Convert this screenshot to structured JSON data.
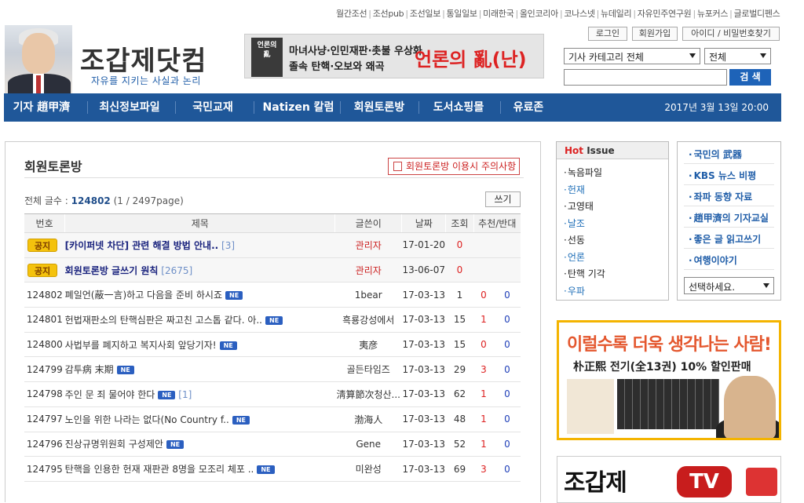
{
  "top_links": [
    "월간조선",
    "조선pub",
    "조선일보",
    "통일일보",
    "미래한국",
    "올인코리아",
    "코나스넷",
    "뉴데일리",
    "자유민주연구원",
    "뉴포커스",
    "글로벌디펜스"
  ],
  "header": {
    "logo_text": "조갑제닷컴",
    "slogan": "자유를 지키는 사실과 논리",
    "banner": {
      "book_title": "언론의 亂",
      "line1": "마녀사냥·인민재판·촛불 우상화",
      "line2": "졸속 탄핵·오보와 왜곡",
      "headline": "언론의 亂(난)"
    },
    "login": "로그인",
    "join": "회원가입",
    "find": "아이디 / 비밀번호찾기",
    "category_select": "기사 카테고리 전체",
    "scope_select": "전체",
    "search_value": "",
    "search_button": "검 색"
  },
  "nav": {
    "items": [
      "기자 趙甲濟",
      "최신정보파일",
      "국민교재",
      "Natizen 칼럼",
      "회원토론방",
      "도서쇼핑몰",
      "유료존"
    ],
    "date": "2017년 3월 13일 20:00"
  },
  "board": {
    "title": "회원토론방",
    "notice_button": "회원토론방 이용시 주의사항",
    "total_label": "전체 글수 :",
    "total_count": "124802",
    "page_info": "(1 / 2497page)",
    "write_button": "쓰기",
    "columns": [
      "번호",
      "제목",
      "글쓴이",
      "날짜",
      "조회",
      "추천/반대"
    ],
    "notices": [
      {
        "badge": "공지",
        "title": "[카이퍼넷 차단] 관련 해결 방법 안내..",
        "comments": "[3]",
        "author": "관리자",
        "date": "17-01-20",
        "views": "0"
      },
      {
        "badge": "공지",
        "title": "회원토론방 글쓰기 원칙",
        "comments": "[2675]",
        "author": "관리자",
        "date": "13-06-07",
        "views": "0"
      }
    ],
    "rows": [
      {
        "no": "124802",
        "title": "폐일언(蔽一言)하고 다음을 준비 하시죠",
        "comments": "",
        "author": "1bear",
        "date": "17-03-13",
        "views": "1",
        "up": "0",
        "down": "0"
      },
      {
        "no": "124801",
        "title": "헌법재판소의 탄핵심판은 짜고친 고스톱 같다. 아..",
        "comments": "",
        "author": "흑룡강성에서",
        "date": "17-03-13",
        "views": "15",
        "up": "1",
        "down": "0"
      },
      {
        "no": "124800",
        "title": "사법부를 폐지하고 복지사회 앞당기자!",
        "comments": "",
        "author": "夷彦",
        "date": "17-03-13",
        "views": "15",
        "up": "0",
        "down": "0"
      },
      {
        "no": "124799",
        "title": "감투病 末期",
        "comments": "",
        "author": "골든타임즈",
        "date": "17-03-13",
        "views": "29",
        "up": "3",
        "down": "0"
      },
      {
        "no": "124798",
        "title": "주인 문 죄 물어야 한다",
        "comments": "[1]",
        "author": "淸算節次청산...",
        "date": "17-03-13",
        "views": "62",
        "up": "1",
        "down": "0"
      },
      {
        "no": "124797",
        "title": "노인을 위한 나라는 없다(No Country f..",
        "comments": "",
        "author": "渤海人",
        "date": "17-03-13",
        "views": "48",
        "up": "1",
        "down": "0"
      },
      {
        "no": "124796",
        "title": "진상규명위원회 구성제안",
        "comments": "",
        "author": "Gene",
        "date": "17-03-13",
        "views": "52",
        "up": "1",
        "down": "0"
      },
      {
        "no": "124795",
        "title": "탄핵을 인용한 헌재 재판관 8명을 모조리 체포 ..",
        "comments": "",
        "author": "미완성",
        "date": "17-03-13",
        "views": "69",
        "up": "3",
        "down": "0"
      }
    ],
    "new_badge": "NE"
  },
  "hot_issue": {
    "title_hot": "Hot",
    "title_rest": " Issue",
    "items": [
      {
        "label": "녹음파일",
        "blue": false
      },
      {
        "label": "헌재",
        "blue": true
      },
      {
        "label": "고영태",
        "blue": false
      },
      {
        "label": "날조",
        "blue": true
      },
      {
        "label": "선동",
        "blue": false
      },
      {
        "label": "언론",
        "blue": true
      },
      {
        "label": "탄핵 기각",
        "blue": false
      },
      {
        "label": "우파",
        "blue": true
      }
    ]
  },
  "right_links": {
    "items": [
      "국민의 武器",
      "KBS 뉴스 비평",
      "좌파 동향 자료",
      "趙甲濟의 기자교실",
      "좋은 글 읽고쓰기",
      "여행이야기"
    ],
    "select": "선택하세요."
  },
  "ads": {
    "ad1_line1": "이럴수록 더욱 생각나는 사람!",
    "ad1_line2": "朴正熙 전기(全13권) 10% 할인판매",
    "ad2_text": "조갑제",
    "ad2_tv": "TV"
  },
  "colors": {
    "nav_bg": "#1f5799",
    "accent_red": "#d22222",
    "search_btn": "#1e63b8",
    "badge": "#f4c20d"
  }
}
